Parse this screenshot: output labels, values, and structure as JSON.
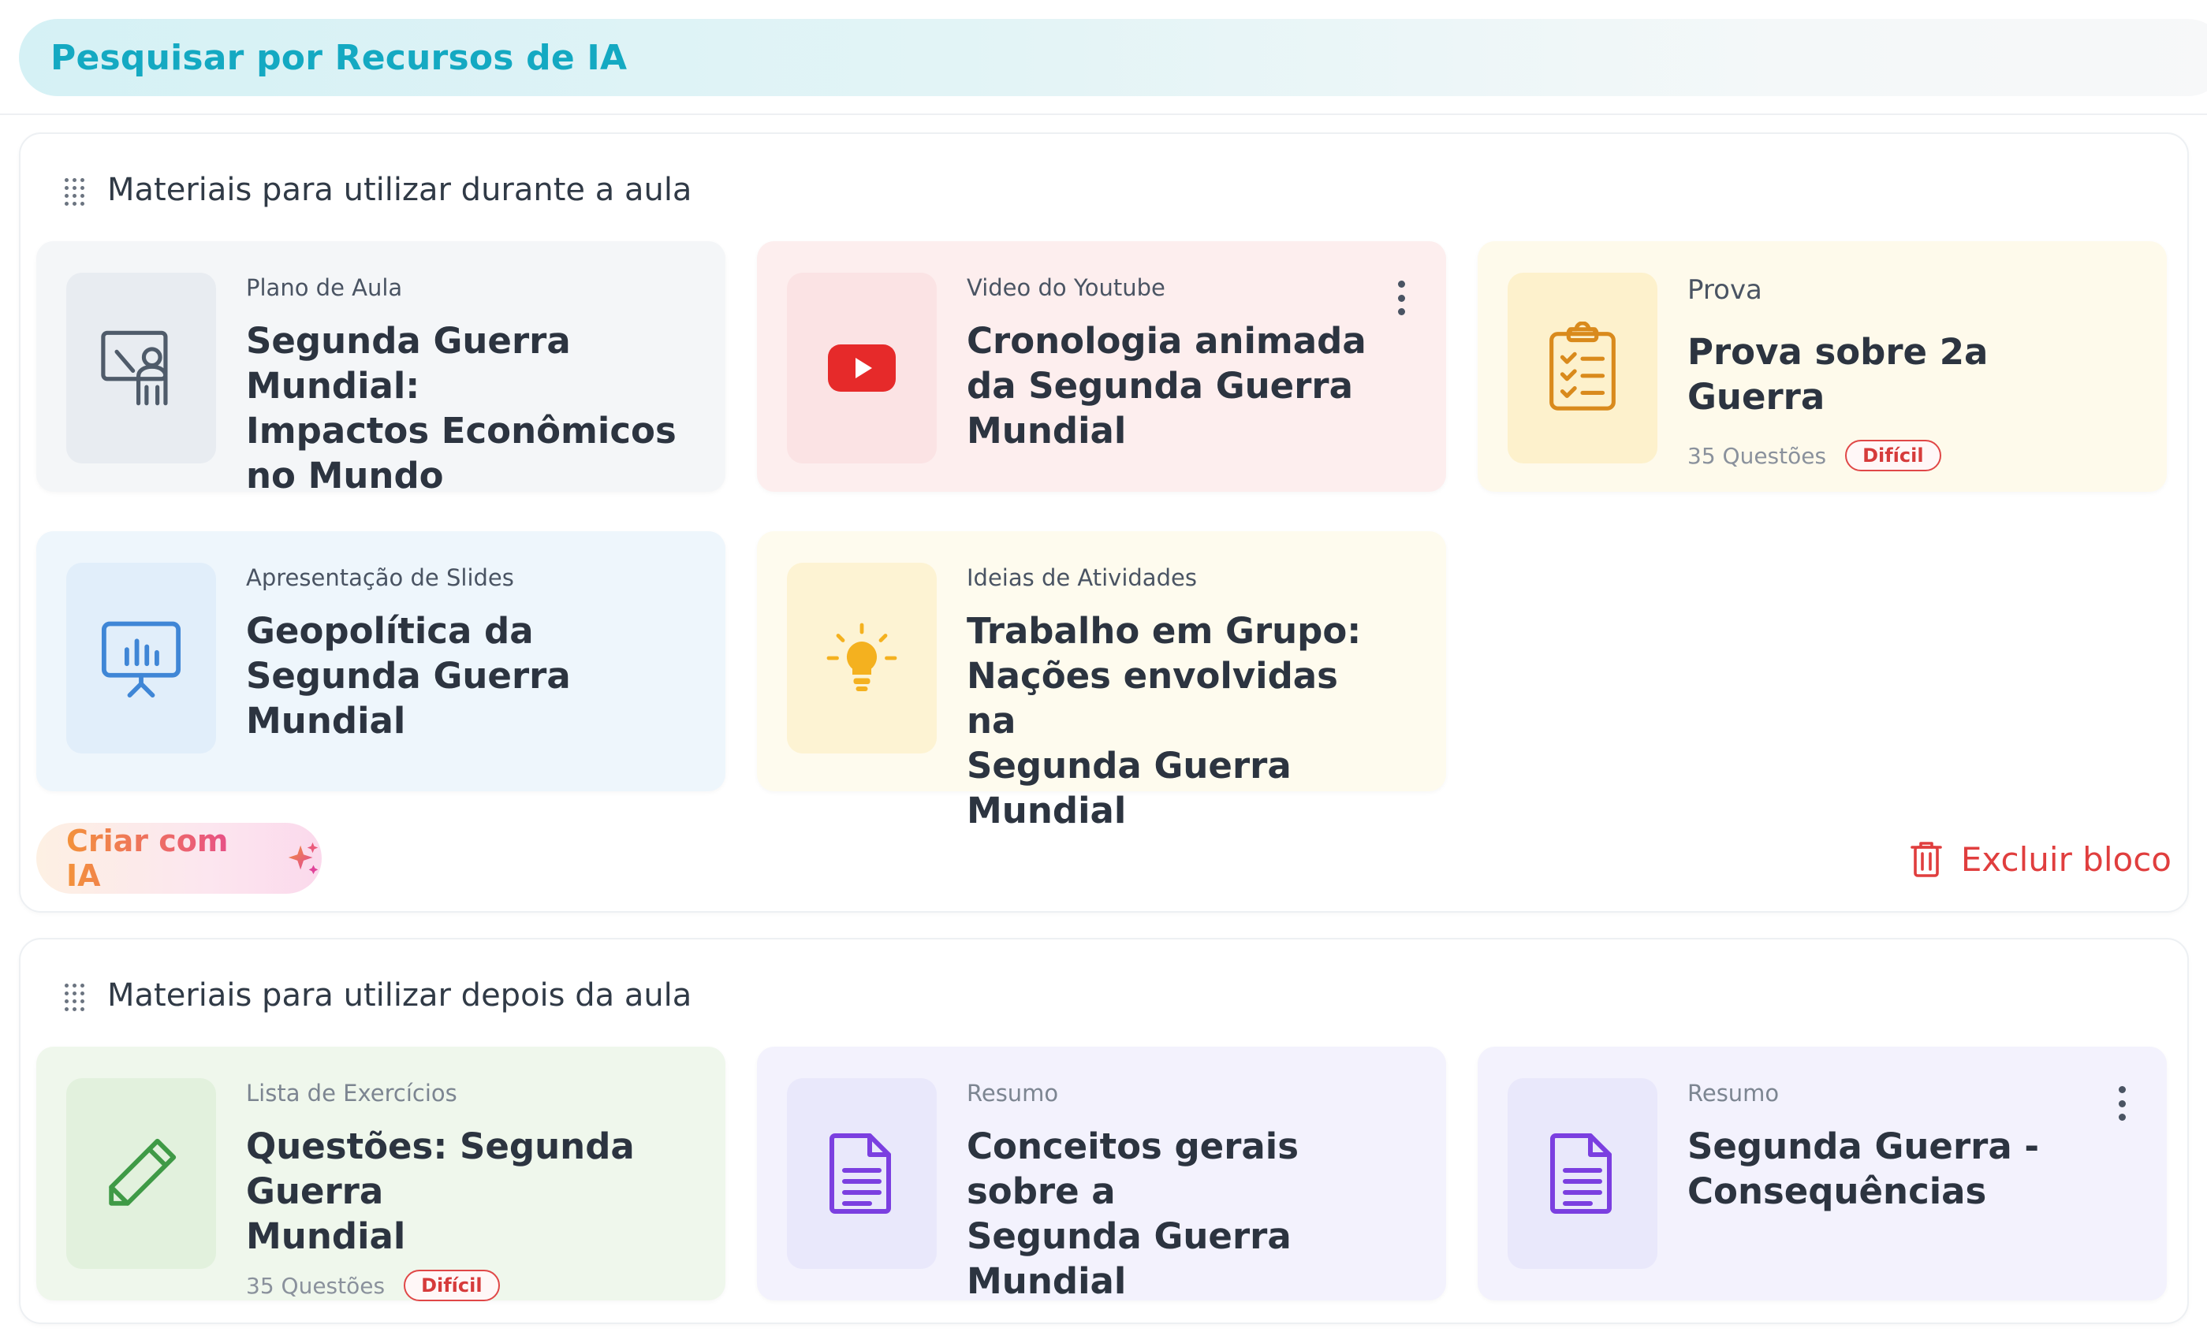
{
  "search": {
    "label": "Pesquisar por Recursos de IA"
  },
  "blocks": [
    {
      "title": "Materiais para utilizar durante a aula",
      "cards": [
        {
          "type": "Plano de Aula",
          "title": "Segunda Guerra Mundial:\nImpactos Econômicos\nno Mundo",
          "icon": "teacher-board-icon"
        },
        {
          "type": "Video do Youtube",
          "title": "Cronologia animada\nda Segunda Guerra\nMundial",
          "icon": "youtube-icon"
        },
        {
          "type": "Prova",
          "title": "Prova sobre 2a Guerra",
          "meta": "35 Questões",
          "badge": "Difícil",
          "icon": "clipboard-checklist-icon"
        },
        {
          "type": "Apresentação de Slides",
          "title": "Geopolítica da\nSegunda Guerra\nMundial",
          "icon": "presentation-chart-icon"
        },
        {
          "type": "Ideias de Atividades",
          "title": "Trabalho em Grupo:\nNações envolvidas na\nSegunda Guerra Mundial",
          "icon": "lightbulb-icon"
        }
      ],
      "create_label": "Criar com IA",
      "delete_label": "Excluir bloco"
    },
    {
      "title": "Materiais para utilizar depois da aula",
      "cards": [
        {
          "type": "Lista de Exercícios",
          "title": "Questões: Segunda Guerra\nMundial",
          "meta": "35 Questões",
          "badge": "Difícil",
          "icon": "pencil-icon"
        },
        {
          "type": "Resumo",
          "title": "Conceitos gerais sobre a\nSegunda Guerra Mundial",
          "icon": "document-icon"
        },
        {
          "type": "Resumo",
          "title": "Segunda Guerra -\nConsequências",
          "icon": "document-icon"
        }
      ]
    }
  ],
  "colors": {
    "search_text": "#14a9c2",
    "badge_red": "#e04747",
    "delete_red": "#e03e3e",
    "youtube_red": "#e62a2a",
    "clipboard_orange": "#d98a1c",
    "bulb_yellow": "#f4b11f",
    "slides_blue": "#3f86d6",
    "pencil_green": "#3f9a46",
    "doc_purple": "#7b3fe0"
  }
}
